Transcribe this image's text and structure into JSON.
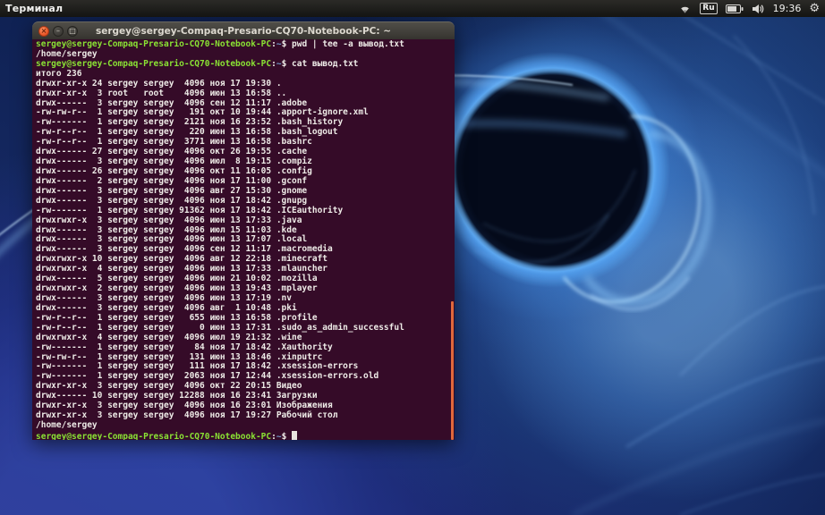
{
  "panel": {
    "active_app_title": "Терминал",
    "keyboard_indicator": "Ru",
    "clock": "19:36"
  },
  "colors": {
    "terminal_background": "#350b28",
    "prompt_green": "#8ae234",
    "path_blue": "#729fcf",
    "scrollbar_orange": "#e0683c",
    "close_button_orange": "#e65124"
  },
  "window": {
    "title": "sergey@sergey-Compaq-Presario-CQ70-Notebook-PC: ~"
  },
  "terminal": {
    "prompt": {
      "user_host": "sergey@sergey-Compaq-Presario-CQ70-Notebook-PC",
      "separator": ":",
      "path": "~",
      "dollar": "$"
    },
    "lines": [
      {
        "cmd": "pwd | tee -a вывод.txt"
      },
      {
        "out": "/home/sergey"
      },
      {
        "cmd": "cat вывод.txt"
      },
      {
        "out": "итого 236"
      },
      {
        "out": "drwxr-xr-x 24 sergey sergey  4096 ноя 17 19:30 ."
      },
      {
        "out": "drwxr-xr-x  3 root   root    4096 июн 13 16:58 .."
      },
      {
        "out": "drwx------  3 sergey sergey  4096 сен 12 11:17 .adobe"
      },
      {
        "out": "-rw-rw-r--  1 sergey sergey   191 окт 10 19:44 .apport-ignore.xml"
      },
      {
        "out": "-rw-------  1 sergey sergey  2121 ноя 16 23:52 .bash_history"
      },
      {
        "out": "-rw-r--r--  1 sergey sergey   220 июн 13 16:58 .bash_logout"
      },
      {
        "out": "-rw-r--r--  1 sergey sergey  3771 июн 13 16:58 .bashrc"
      },
      {
        "out": "drwx------ 27 sergey sergey  4096 окт 26 19:55 .cache"
      },
      {
        "out": "drwx------  3 sergey sergey  4096 июл  8 19:15 .compiz"
      },
      {
        "out": "drwx------ 26 sergey sergey  4096 окт 11 16:05 .config"
      },
      {
        "out": "drwx------  2 sergey sergey  4096 ноя 17 11:00 .gconf"
      },
      {
        "out": "drwx------  3 sergey sergey  4096 авг 27 15:30 .gnome"
      },
      {
        "out": "drwx------  3 sergey sergey  4096 ноя 17 18:42 .gnupg"
      },
      {
        "out": "-rw-------  1 sergey sergey 91362 ноя 17 18:42 .ICEauthority"
      },
      {
        "out": "drwxrwxr-x  3 sergey sergey  4096 июн 13 17:33 .java"
      },
      {
        "out": "drwx------  3 sergey sergey  4096 июл 15 11:03 .kde"
      },
      {
        "out": "drwx------  3 sergey sergey  4096 июн 13 17:07 .local"
      },
      {
        "out": "drwx------  3 sergey sergey  4096 сен 12 11:17 .macromedia"
      },
      {
        "out": "drwxrwxr-x 10 sergey sergey  4096 авг 12 22:18 .minecraft"
      },
      {
        "out": "drwxrwxr-x  4 sergey sergey  4096 июн 13 17:33 .mlauncher"
      },
      {
        "out": "drwx------  5 sergey sergey  4096 июн 21 10:02 .mozilla"
      },
      {
        "out": "drwxrwxr-x  2 sergey sergey  4096 июн 13 19:43 .mplayer"
      },
      {
        "out": "drwx------  3 sergey sergey  4096 июн 13 17:19 .nv"
      },
      {
        "out": "drwx------  3 sergey sergey  4096 авг  1 10:48 .pki"
      },
      {
        "out": "-rw-r--r--  1 sergey sergey   655 июн 13 16:58 .profile"
      },
      {
        "out": "-rw-r--r--  1 sergey sergey     0 июн 13 17:31 .sudo_as_admin_successful"
      },
      {
        "out": "drwxrwxr-x  4 sergey sergey  4096 июл 19 21:32 .wine"
      },
      {
        "out": "-rw-------  1 sergey sergey    84 ноя 17 18:42 .Xauthority"
      },
      {
        "out": "-rw-rw-r--  1 sergey sergey   131 июн 13 18:46 .xinputrc"
      },
      {
        "out": "-rw-------  1 sergey sergey   111 ноя 17 18:42 .xsession-errors"
      },
      {
        "out": "-rw-------  1 sergey sergey  2063 ноя 17 12:44 .xsession-errors.old"
      },
      {
        "out": "drwxr-xr-x  3 sergey sergey  4096 окт 22 20:15 Видео"
      },
      {
        "out": "drwx------ 10 sergey sergey 12288 ноя 16 23:41 Загрузки"
      },
      {
        "out": "drwxr-xr-x  3 sergey sergey  4096 ноя 16 23:01 Изображения"
      },
      {
        "out": "drwxr-xr-x  3 sergey sergey  4096 ноя 17 19:27 Рабочий стол"
      },
      {
        "out": "/home/sergey"
      },
      {
        "cmd": "",
        "cursor": true
      }
    ]
  }
}
